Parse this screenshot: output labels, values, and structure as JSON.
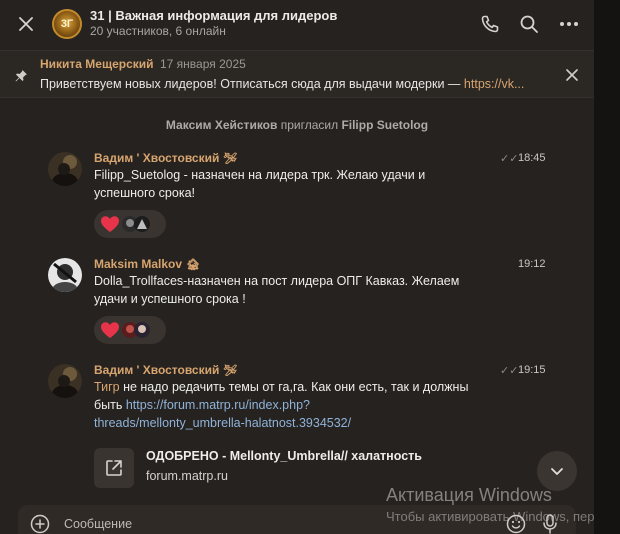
{
  "header": {
    "avatar_text": "3Г",
    "title": "31 | Важная информация для лидеров",
    "subtitle": "20 участников, 6 онлайн"
  },
  "pinned": {
    "author": "Никита Мещерский",
    "date": "17 января 2025",
    "text": "Приветствуем новых лидеров! Отписаться сюда для выдачи модерки — ",
    "link": "https://vk..."
  },
  "service": {
    "actor": "Максим Хейстиков",
    "action": "пригласил",
    "target": "Filipp Suetolog"
  },
  "messages": [
    {
      "author": "Вадим ' Хвостовский",
      "badge": "🛩",
      "time": "18:45",
      "ticks": "✓✓",
      "text": "Filipp_Suetolog - назначен на лидера трк. Желаю удачи и успешного срока!"
    },
    {
      "author": "Maksim Malkov",
      "badge": "🏚",
      "time": "19:12",
      "text": "Dolla_Trollfaces-назначен на пост лидера ОПГ Кавказ. Желаем удачи и успешного срока !"
    },
    {
      "author": "Вадим ' Хвостовский",
      "badge": "🛩",
      "time": "19:15",
      "ticks": "✓✓",
      "mention": "Тигр",
      "text": " не надо редачить темы от га,га. Как они есть, так и должны быть ",
      "link": "https://forum.matrp.ru/index.php?threads/mellonty_umbrella-halatnost.3934532/",
      "link_line1": "https://forum.matrp.ru/index.php?",
      "link_line2": "threads/mellonty_umbrella-halatnost.3934532/",
      "preview_title": "ОДОБРЕНО - Mellonty_Umbrella// халатность",
      "preview_domain": "forum.matrp.ru"
    }
  ],
  "composer": {
    "placeholder": "Сообщение"
  },
  "watermark": {
    "title": "Активация Windows",
    "subtitle": "Чтобы активировать Windows, пер"
  },
  "colors": {
    "accent": "#d7a56f",
    "link": "#8fb3d9",
    "background": "#26221f",
    "reaction_heart": "#e8344a"
  }
}
